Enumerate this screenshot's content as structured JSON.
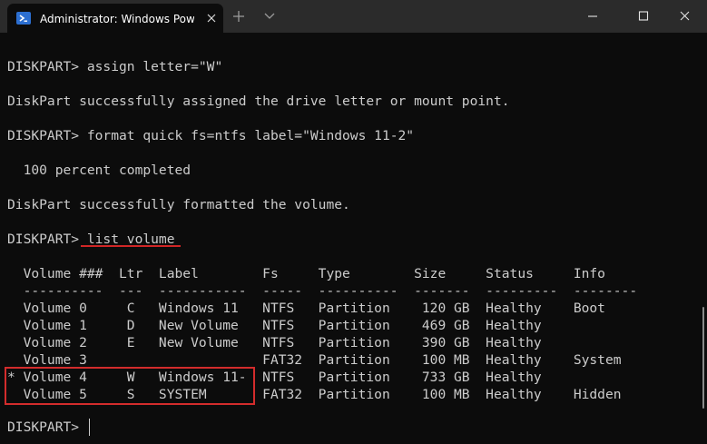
{
  "titlebar": {
    "tab_title": "Administrator: Windows PowerShell",
    "tab_icon": "powershell-icon",
    "close_icon": "close-icon",
    "new_tab_icon": "plus-icon",
    "dropdown_icon": "chevron-down-icon",
    "minimize_icon": "minimize-icon",
    "maximize_icon": "maximize-icon",
    "window_close_icon": "close-icon"
  },
  "terminal": {
    "lines": [
      "DISKPART> assign letter=\"W\"",
      "",
      "DiskPart successfully assigned the drive letter or mount point.",
      "",
      "DISKPART> format quick fs=ntfs label=\"Windows 11-2\"",
      "",
      "  100 percent completed",
      "",
      "DiskPart successfully formatted the volume.",
      "",
      "DISKPART> list volume",
      "",
      "  Volume ###  Ltr  Label        Fs     Type        Size     Status     Info",
      "  ----------  ---  -----------  -----  ----------  -------  ---------  --------",
      "  Volume 0     C   Windows 11   NTFS   Partition    120 GB  Healthy    Boot",
      "  Volume 1     D   New Volume   NTFS   Partition    469 GB  Healthy",
      "  Volume 2     E   New Volume   NTFS   Partition    390 GB  Healthy",
      "  Volume 3                      FAT32  Partition    100 MB  Healthy    System",
      "* Volume 4     W   Windows 11-  NTFS   Partition    733 GB  Healthy",
      "  Volume 5     S   SYSTEM       FAT32  Partition    100 MB  Healthy    Hidden",
      "",
      "DISKPART> "
    ],
    "underlined_command": "list volume",
    "highlighted_volumes": [
      "Volume 4",
      "Volume 5"
    ]
  },
  "colors": {
    "titlebar_bg": "#2b2b2b",
    "terminal_bg": "#0c0c0c",
    "text": "#cccccc",
    "annotation_red": "#d32c2c",
    "powershell_blue": "#2c6fd1"
  }
}
